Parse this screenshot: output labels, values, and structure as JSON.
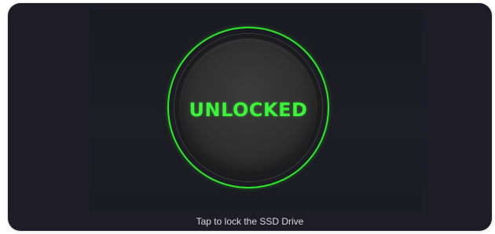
{
  "lock_panel": {
    "status": "UNLOCKED",
    "hint": "Tap to lock the SSD Drive"
  },
  "colors": {
    "background": "#1e1d27",
    "accent_green": "#3cf23a",
    "button_face": "#303030"
  }
}
